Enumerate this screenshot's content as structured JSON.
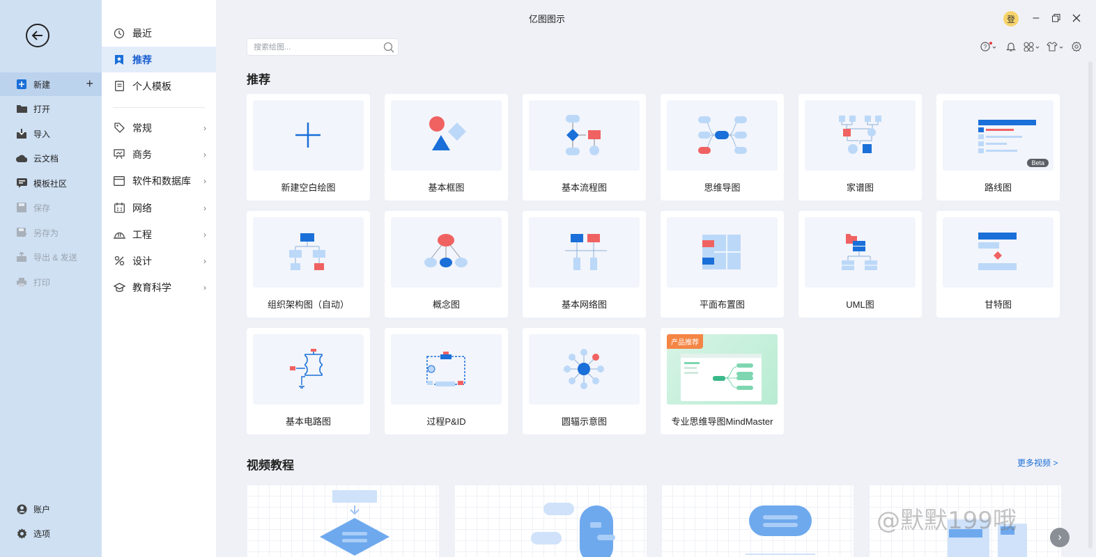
{
  "window": {
    "title": "亿图图示",
    "login_label": "登"
  },
  "sidebar": {
    "items": [
      {
        "label": "新建",
        "icon": "plus-square-icon"
      },
      {
        "label": "打开",
        "icon": "folder-icon"
      },
      {
        "label": "导入",
        "icon": "import-icon"
      },
      {
        "label": "云文档",
        "icon": "cloud-icon"
      },
      {
        "label": "模板社区",
        "icon": "community-icon"
      },
      {
        "label": "保存",
        "icon": "save-icon"
      },
      {
        "label": "另存为",
        "icon": "save-as-icon"
      },
      {
        "label": "导出 & 发送",
        "icon": "export-icon"
      },
      {
        "label": "打印",
        "icon": "print-icon"
      }
    ],
    "bottom": [
      {
        "label": "账户",
        "icon": "account-icon"
      },
      {
        "label": "选项",
        "icon": "gear-icon"
      }
    ]
  },
  "categories": {
    "top": [
      {
        "label": "最近"
      },
      {
        "label": "推荐"
      },
      {
        "label": "个人模板"
      }
    ],
    "groups": [
      {
        "label": "常规"
      },
      {
        "label": "商务"
      },
      {
        "label": "软件和数据库"
      },
      {
        "label": "网络"
      },
      {
        "label": "工程"
      },
      {
        "label": "设计"
      },
      {
        "label": "教育科学"
      }
    ]
  },
  "search": {
    "placeholder": "搜索绘图..."
  },
  "main": {
    "section_title": "推荐",
    "templates": [
      {
        "label": "新建空白绘图"
      },
      {
        "label": "基本框图"
      },
      {
        "label": "基本流程图"
      },
      {
        "label": "思维导图"
      },
      {
        "label": "家谱图"
      },
      {
        "label": "路线图",
        "badge": "Beta"
      },
      {
        "label": "组织架构图（自动）"
      },
      {
        "label": "概念图"
      },
      {
        "label": "基本网络图"
      },
      {
        "label": "平面布置图"
      },
      {
        "label": "UML图"
      },
      {
        "label": "甘特图"
      },
      {
        "label": "基本电路图"
      },
      {
        "label": "过程P&ID"
      },
      {
        "label": "圆辐示意图"
      },
      {
        "label": "专业思维导图MindMaster",
        "badge": "产品推荐"
      }
    ],
    "video_title": "视频教程",
    "more_videos": "更多视频 >"
  },
  "watermark": "@默默199哦",
  "colors": {
    "accent": "#1a6fd8",
    "red": "#f06262",
    "lightblue": "#bcd8f8"
  }
}
